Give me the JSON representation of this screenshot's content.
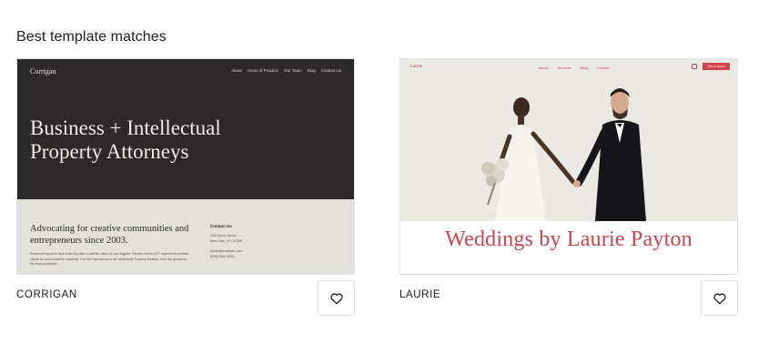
{
  "section": {
    "title": "Best template matches"
  },
  "templates": [
    {
      "name": "CORRIGAN",
      "preview": {
        "logo": "Corrigan",
        "nav": [
          "About",
          "Areas of Practice",
          "Our Team",
          "Blog",
          "Contact Us"
        ],
        "headline": "Business + Intellectual Property Attorneys",
        "subheadline": "Advocating for creative communities and entrepreneurs since 2003.",
        "body": "Practiced based in New York City with a satellite office in Los Angeles. Partner Hamer & P represents creative clients in world between creativity. Our firm specializes in all Intellectual Property Matters, from the ground to the final production.",
        "contact": {
          "heading": "Contact Us",
          "address_1": "123 Demo Street",
          "address_2": "New York, NY 12345",
          "email": "email@example.com",
          "phone": "(555) 555-5555"
        },
        "colors": {
          "dark": "#2b2929",
          "light": "#e2e2da"
        }
      }
    },
    {
      "name": "LAURIE",
      "preview": {
        "logo": "Laurie",
        "nav": [
          "About",
          "Services",
          "Blog",
          "Contact"
        ],
        "cta": "Get in touch",
        "headline": "Weddings by Laurie Payton",
        "colors": {
          "accent": "#c9444f",
          "background": "#ebe9e4"
        }
      }
    }
  ],
  "icons": {
    "favorite": "heart-outline-icon",
    "instagram": "instagram-icon"
  }
}
